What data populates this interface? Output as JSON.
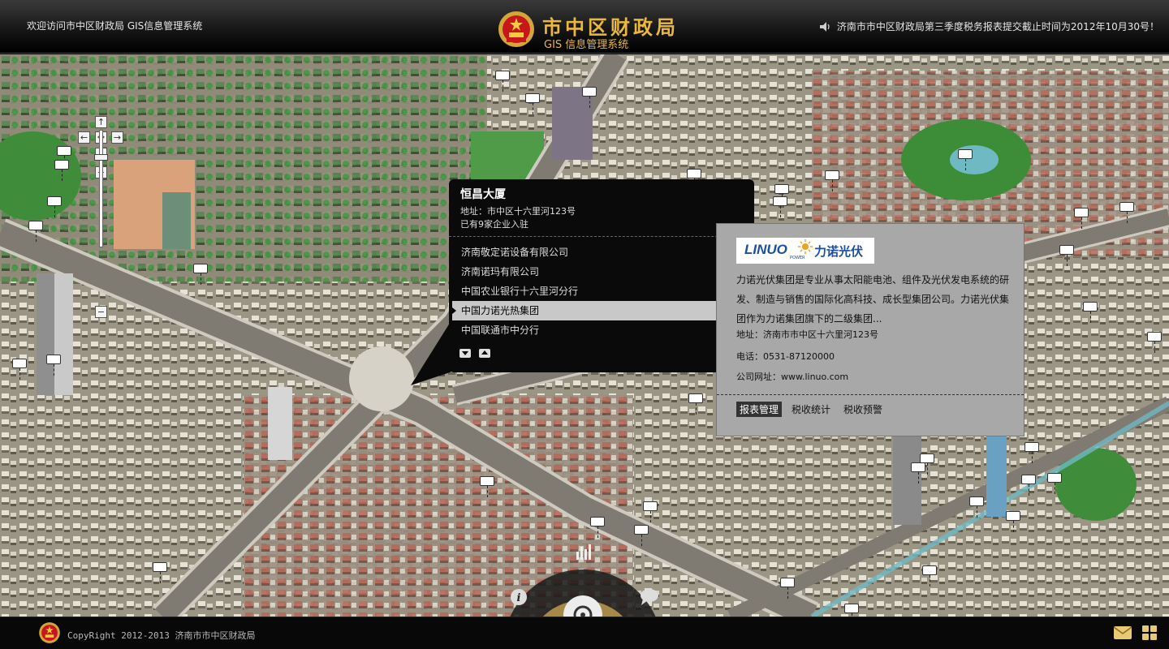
{
  "header": {
    "welcome": "欢迎访问市中区财政局 GIS信息管理系统",
    "brand_title": "市中区财政局",
    "brand_subtitle": "GIS 信息管理系统",
    "notice": "济南市市中区财政局第三季度税务报表提交截止时间为2012年10月30号！"
  },
  "map_controls": {
    "pan_up": "↑",
    "pan_left": "←",
    "pan_center": "✥",
    "pan_right": "→",
    "pan_down": "↓",
    "zoom_in": "+",
    "zoom_out": "−",
    "zoom_level": 0.22
  },
  "building": {
    "name": "恒昌大厦",
    "address": "地址：市中区十六里河123号",
    "company_count": "已有9家企业入驻",
    "companies": [
      "济南敬定诺设备有限公司",
      "济南诺玛有限公司",
      "中国农业银行十六里河分行",
      "中国力诺光热集团",
      "中国联通市中分行"
    ],
    "selected_index": 3
  },
  "company": {
    "logo_latin": "LINUO",
    "logo_cn": "力诺光伏",
    "logo_power": "POWER",
    "description": "力诺光伏集团是专业从事太阳能电池、组件及光伏发电系统的研发、制造与销售的国际化高科技、成长型集团公司。力诺光伏集团作为力诺集团旗下的二级集团...",
    "address": "地址：济南市市中区十六里河123号",
    "phone": "电话：0531-87120000",
    "website": "公司网址：www.linuo.com",
    "tabs": [
      "报表管理",
      "税收统计",
      "税收预警"
    ],
    "active_tab": 0
  },
  "footer": {
    "copyright": "CopyRight 2012-2013 济南市市中区财政局"
  },
  "colors": {
    "brand_gold": "#e8b840",
    "logo_blue": "#1b4fa0",
    "panel_gray": "#a8a8a8"
  }
}
